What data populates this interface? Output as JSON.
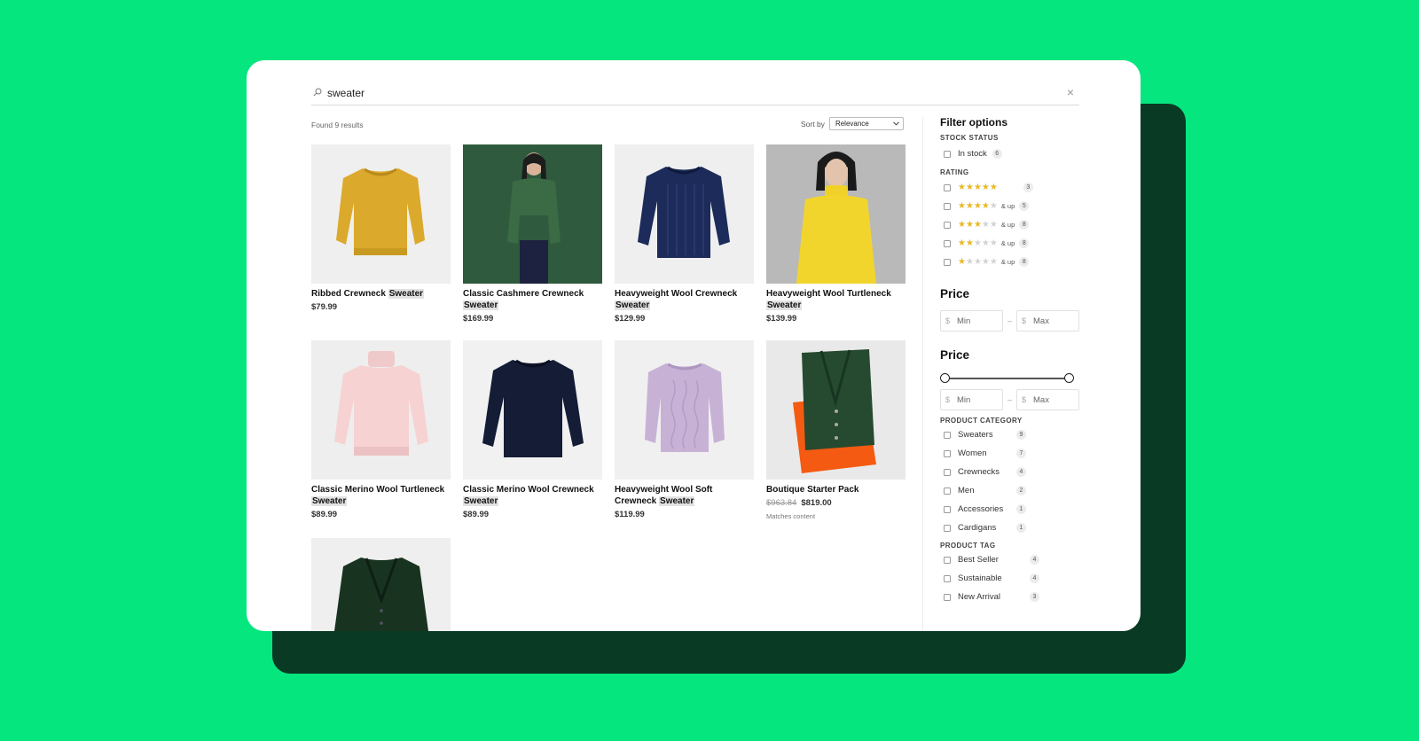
{
  "search": {
    "query": "sweater",
    "close_label": "×"
  },
  "results": {
    "found_label": "Found 9 results"
  },
  "sort": {
    "label": "Sort by",
    "value": "Relevance"
  },
  "products": [
    {
      "name": "Ribbed Crewneck",
      "highlight": "Sweater",
      "price": "$79.99"
    },
    {
      "name": "Classic Cashmere Crewneck",
      "highlight": "Sweater",
      "price": "$169.99"
    },
    {
      "name": "Heavyweight Wool Crewneck",
      "highlight": "Sweater",
      "price": "$129.99"
    },
    {
      "name": "Heavyweight Wool Turtleneck",
      "highlight": "Sweater",
      "price": "$139.99"
    },
    {
      "name": "Classic Merino Wool Turtleneck",
      "highlight": "Sweater",
      "price": "$89.99"
    },
    {
      "name": "Classic Merino Wool Crewneck",
      "highlight": "Sweater",
      "price": "$89.99"
    },
    {
      "name": "Heavyweight Wool Soft Crewneck",
      "highlight": "Sweater",
      "price": "$119.99"
    },
    {
      "name": "Boutique Starter Pack",
      "old_price": "$963.84",
      "price": "$819.00",
      "note": "Matches content"
    }
  ],
  "filters": {
    "title": "Filter options",
    "stock": {
      "heading": "STOCK STATUS",
      "items": [
        {
          "label": "In stock",
          "count": "6"
        }
      ]
    },
    "rating": {
      "heading": "RATING",
      "and_up": "& up",
      "items": [
        {
          "stars": 5,
          "count": "3"
        },
        {
          "stars": 4,
          "count": "5"
        },
        {
          "stars": 3,
          "count": "8"
        },
        {
          "stars": 2,
          "count": "8"
        },
        {
          "stars": 1,
          "count": "8"
        }
      ]
    },
    "price_inputs": {
      "heading": "Price",
      "currency": "$",
      "min_placeholder": "Min",
      "max_placeholder": "Max",
      "separator": "–"
    },
    "price_slider": {
      "heading": "Price",
      "currency": "$",
      "min_placeholder": "Min",
      "max_placeholder": "Max",
      "separator": "–",
      "range_min_fraction": 0,
      "range_max_fraction": 1
    },
    "category": {
      "heading": "PRODUCT CATEGORY",
      "items": [
        {
          "label": "Sweaters",
          "count": "9"
        },
        {
          "label": "Women",
          "count": "7"
        },
        {
          "label": "Crewnecks",
          "count": "4"
        },
        {
          "label": "Men",
          "count": "2"
        },
        {
          "label": "Accessories",
          "count": "1"
        },
        {
          "label": "Cardigans",
          "count": "1"
        }
      ]
    },
    "tag": {
      "heading": "PRODUCT TAG",
      "items": [
        {
          "label": "Best Seller",
          "count": "4"
        },
        {
          "label": "Sustainable",
          "count": "4"
        },
        {
          "label": "New Arrival",
          "count": "3"
        }
      ]
    }
  },
  "colors": {
    "page_background": "#05E67F",
    "backdrop": "#093A24",
    "star_active": "#E8B923",
    "star_inactive": "#d3d3d3"
  },
  "icons": {
    "search": "search-icon",
    "close": "close-icon",
    "sort_chevron": "chevron-down-icon",
    "star": "star-icon"
  }
}
